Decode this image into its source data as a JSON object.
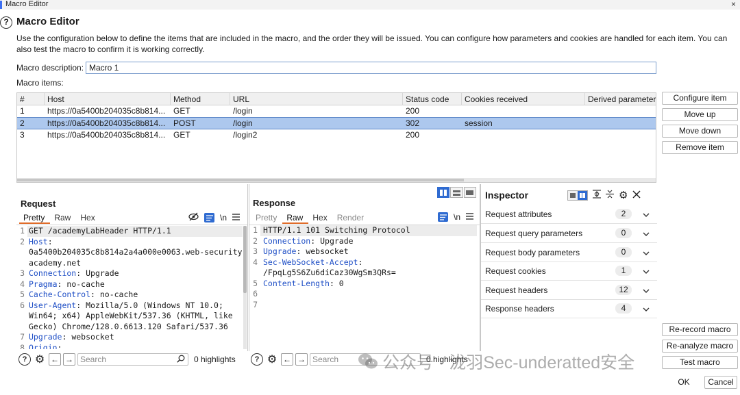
{
  "window": {
    "title": "Macro Editor",
    "close_glyph": "×"
  },
  "dialog": {
    "help_glyph": "?",
    "title": "Macro Editor",
    "description": "Use the configuration below to define the items that are included in the macro, and the order they will be issued. You can configure how parameters and cookies are handled for each item. You can also test the macro to confirm it is working correctly."
  },
  "macro_description": {
    "label": "Macro description:",
    "value": "Macro 1"
  },
  "macro_items": {
    "label": "Macro items:",
    "columns": [
      "#",
      "Host",
      "Method",
      "URL",
      "Status code",
      "Cookies received",
      "Derived parameters"
    ],
    "rows": [
      {
        "num": "1",
        "host": "https://0a5400b204035c8b814...",
        "method": "GET",
        "url": "/login",
        "status": "200",
        "cookies": "",
        "selected": false
      },
      {
        "num": "2",
        "host": "https://0a5400b204035c8b814...",
        "method": "POST",
        "url": "/login",
        "status": "302",
        "cookies": "session",
        "selected": true
      },
      {
        "num": "3",
        "host": "https://0a5400b204035c8b814...",
        "method": "GET",
        "url": "/login2",
        "status": "200",
        "cookies": "",
        "selected": false
      }
    ]
  },
  "side_buttons": {
    "configure": "Configure item",
    "move_up": "Move up",
    "move_down": "Move down",
    "remove": "Remove item"
  },
  "request": {
    "title": "Request",
    "tabs": [
      "Pretty",
      "Raw",
      "Hex"
    ],
    "active_tab": "Pretty",
    "newline_glyph": "\\n",
    "lines": [
      {
        "n": "1",
        "key": "",
        "text": "GET /academyLabHeader HTTP/1.1"
      },
      {
        "n": "2",
        "key": "Host",
        "text": ":"
      },
      {
        "n": "",
        "key": "",
        "text": "0a5400b204035c8b814a2a4a000e0063.web-security-"
      },
      {
        "n": "",
        "key": "",
        "text": "academy.net"
      },
      {
        "n": "3",
        "key": "Connection",
        "text": ": Upgrade"
      },
      {
        "n": "4",
        "key": "Pragma",
        "text": ": no-cache"
      },
      {
        "n": "5",
        "key": "Cache-Control",
        "text": ": no-cache"
      },
      {
        "n": "6",
        "key": "User-Agent",
        "text": ": Mozilla/5.0 (Windows NT 10.0;"
      },
      {
        "n": "",
        "key": "",
        "text": "Win64; x64) AppleWebKit/537.36 (KHTML, like"
      },
      {
        "n": "",
        "key": "",
        "text": "Gecko) Chrome/128.0.6613.120 Safari/537.36"
      },
      {
        "n": "7",
        "key": "Upgrade",
        "text": ": websocket"
      },
      {
        "n": "8",
        "key": "Origin",
        "text": ":"
      }
    ],
    "search_placeholder": "Search",
    "highlights": "0 highlights"
  },
  "response": {
    "title": "Response",
    "tabs": [
      "Pretty",
      "Raw",
      "Hex",
      "Render"
    ],
    "active_tab": "Raw",
    "newline_glyph": "\\n",
    "lines": [
      {
        "n": "1",
        "key": "",
        "text": "HTTP/1.1 101 Switching Protocol"
      },
      {
        "n": "2",
        "key": "Connection",
        "text": ": Upgrade"
      },
      {
        "n": "3",
        "key": "Upgrade",
        "text": ": websocket"
      },
      {
        "n": "4",
        "key": "Sec-WebSocket-Accept",
        "text": ":"
      },
      {
        "n": "",
        "key": "",
        "text": "/FpqLg5S6Zu6diCaz30WgSm3QRs="
      },
      {
        "n": "5",
        "key": "Content-Length",
        "text": ": 0"
      },
      {
        "n": "6",
        "key": "",
        "text": ""
      },
      {
        "n": "7",
        "key": "",
        "text": ""
      }
    ],
    "search_placeholder": "Search",
    "highlights": "0 highlights"
  },
  "inspector": {
    "title": "Inspector",
    "rows": [
      {
        "name": "Request attributes",
        "count": "2"
      },
      {
        "name": "Request query parameters",
        "count": "0"
      },
      {
        "name": "Request body parameters",
        "count": "0"
      },
      {
        "name": "Request cookies",
        "count": "1"
      },
      {
        "name": "Request headers",
        "count": "12"
      },
      {
        "name": "Response headers",
        "count": "4"
      }
    ]
  },
  "actions": {
    "rerecord": "Re-record macro",
    "reanalyze": "Re-analyze macro",
    "test": "Test macro",
    "ok": "OK",
    "cancel": "Cancel"
  },
  "watermark": {
    "text": "公众号 · 泷羽Sec-underatted安全"
  },
  "colors": {
    "accent": "#2f6bd1",
    "selection": "#adc8ee",
    "header_key": "#1f4fc6",
    "tab_underline": "#e06c2a"
  }
}
